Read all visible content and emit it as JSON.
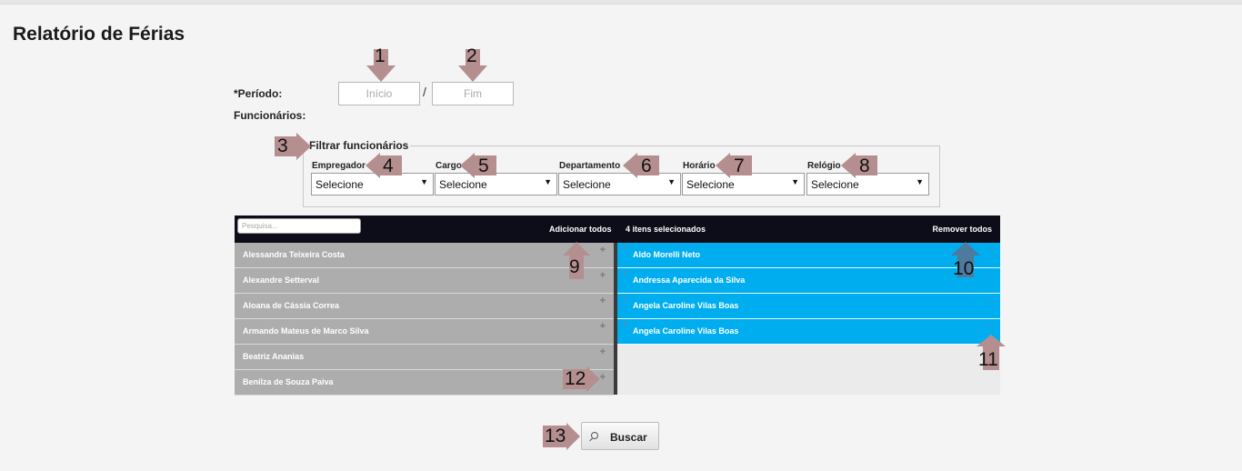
{
  "page": {
    "title": "Relatório de Férias"
  },
  "form": {
    "periodo_label": "*Período:",
    "inicio_placeholder": "Início",
    "fim_placeholder": "Fim",
    "separator": "/",
    "funcionarios_label": "Funcionários:"
  },
  "filter": {
    "legend": "Filtrar funcionários",
    "fields": [
      {
        "label": "Empregador",
        "value": "Selecione"
      },
      {
        "label": "Cargo",
        "value": "Selecione"
      },
      {
        "label": "Departamento",
        "value": "Selecione"
      },
      {
        "label": "Horário",
        "value": "Selecione"
      },
      {
        "label": "Relógio",
        "value": "Selecione"
      }
    ]
  },
  "picker": {
    "search_placeholder": "Pesquisa...",
    "add_all": "Adicionar todos",
    "selected_count": "4 itens selecionados",
    "remove_all": "Remover todos",
    "available": [
      "Alessandra Teixeira Costa",
      "Alexandre Setterval",
      "Aloana de Cássia Correa",
      "Armando Mateus de Marco Silva",
      "Beatriz Ananias",
      "Benilza de Souza Paiva"
    ],
    "selected": [
      "Aldo Morelli Neto",
      "Andressa Aparecida da Silva",
      "Angela Caroline Vilas Boas",
      "Angela Caroline Vilas Boas"
    ],
    "add_icon": "+",
    "remove_icon": "−",
    "handle_icon": "⇕"
  },
  "buscar": {
    "label": "Buscar",
    "icon": "search-icon"
  },
  "annotations": [
    "1",
    "2",
    "3",
    "4",
    "5",
    "6",
    "7",
    "8",
    "9",
    "10",
    "11",
    "12",
    "13"
  ],
  "colors": {
    "selected_bg": "#00aeef",
    "header_bg": "#0d0d1a",
    "annotation_arrow": "#b58f8f",
    "annotation_arrow_blue": "#4e7a9e"
  }
}
